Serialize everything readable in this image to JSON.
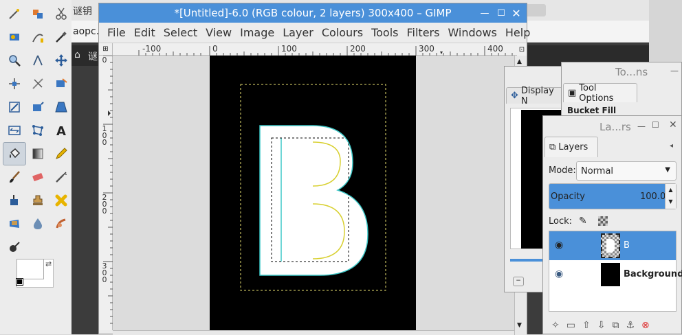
{
  "gimp": {
    "window_title": "*[Untitled]-6.0 (RGB colour, 2 layers) 300x400 – GIMP",
    "menu": [
      "File",
      "Edit",
      "Select",
      "View",
      "Image",
      "Layer",
      "Colours",
      "Tools",
      "Filters",
      "Windows",
      "Help"
    ],
    "hruler_labels": [
      "-100",
      "0",
      "100",
      "200",
      "300",
      "400"
    ],
    "vruler_labels": [
      [
        "0"
      ],
      [
        "1",
        "0",
        "0"
      ],
      [
        "2",
        "0",
        "0"
      ],
      [
        "3",
        "0",
        "0"
      ]
    ],
    "canvas_letter": "B"
  },
  "browser": {
    "tab_text": "谜钥",
    "address_text": "aopc.b",
    "nav_text": "谜"
  },
  "tool_options_panel": {
    "title": "To...ns",
    "tab_label": "Tool Options",
    "tool_name": "Bucket Fill"
  },
  "display_panel": {
    "tab_label": "Display N"
  },
  "layers_panel": {
    "title": "La...rs",
    "tab_label": "Layers",
    "mode_label": "Mode:",
    "mode_value": "Normal",
    "opacity_label": "Opacity",
    "opacity_value": "100.0",
    "lock_label": "Lock:",
    "layers": [
      {
        "name": "B",
        "selected": true
      },
      {
        "name": "Background",
        "selected": false
      }
    ]
  },
  "colors": {
    "titlebar": "#4a90d9",
    "selection_blue": "#4a90d9",
    "canvas_black": "#000000"
  }
}
